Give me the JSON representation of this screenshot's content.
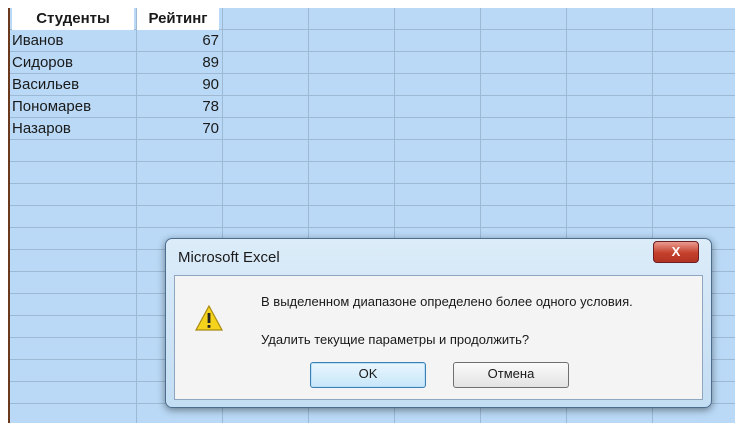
{
  "sheet": {
    "headers": {
      "students": "Студенты",
      "rating": "Рейтинг"
    },
    "rows": [
      {
        "name": "Иванов",
        "score": "67"
      },
      {
        "name": "Сидоров",
        "score": "89"
      },
      {
        "name": "Васильев",
        "score": "90"
      },
      {
        "name": "Пономарев",
        "score": "78"
      },
      {
        "name": "Назаров",
        "score": "70"
      }
    ]
  },
  "dialog": {
    "title": "Microsoft Excel",
    "close_label": "X",
    "icon": "warning-icon",
    "message_line1": "В выделенном диапазоне определено более одного условия.",
    "message_line2": "Удалить текущие параметры и продолжить?",
    "ok_label": "OK",
    "cancel_label": "Отмена"
  },
  "colors": {
    "selection": "#b9d9f6",
    "gridline": "#9db9d4",
    "sheet_border": "#6b3a1e",
    "close_button": "#c4402c",
    "warning": "#f5d21b"
  }
}
